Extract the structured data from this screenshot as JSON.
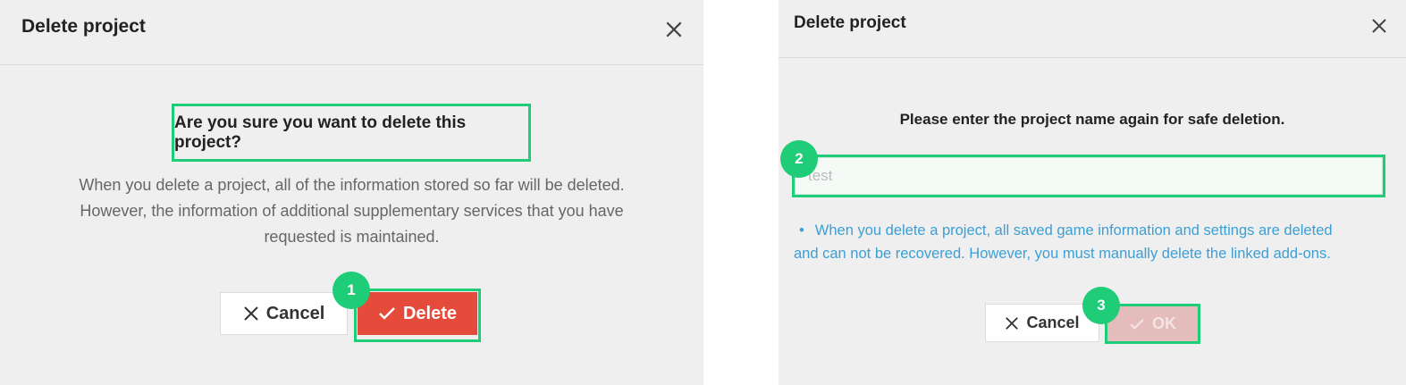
{
  "left_dialog": {
    "title": "Delete project",
    "question": "Are you sure you want to delete this project?",
    "description_lines": [
      "When you delete a project, all of the information stored so far will be deleted.",
      "However, the information of additional supplementary services that you have",
      "requested is maintained."
    ],
    "cancel_label": "Cancel",
    "delete_label": "Delete",
    "step_badge": "1"
  },
  "right_dialog": {
    "title": "Delete project",
    "prompt": "Please enter the project name again for safe deletion.",
    "input_value": "test",
    "note_lines": [
      "When you delete a project, all saved game information and settings are deleted",
      "and can not be recovered. However, you must manually delete the linked add-ons."
    ],
    "cancel_label": "Cancel",
    "ok_label": "OK",
    "input_badge": "2",
    "ok_badge": "3"
  },
  "colors": {
    "dialog_bg": "#efefef",
    "highlight": "#1fcc78",
    "delete_button": "#e54b3a",
    "ok_button_disabled": "#e4bcbc",
    "note_text": "#3b9fd6"
  },
  "icons": [
    "close-icon",
    "x-icon",
    "check-icon"
  ]
}
